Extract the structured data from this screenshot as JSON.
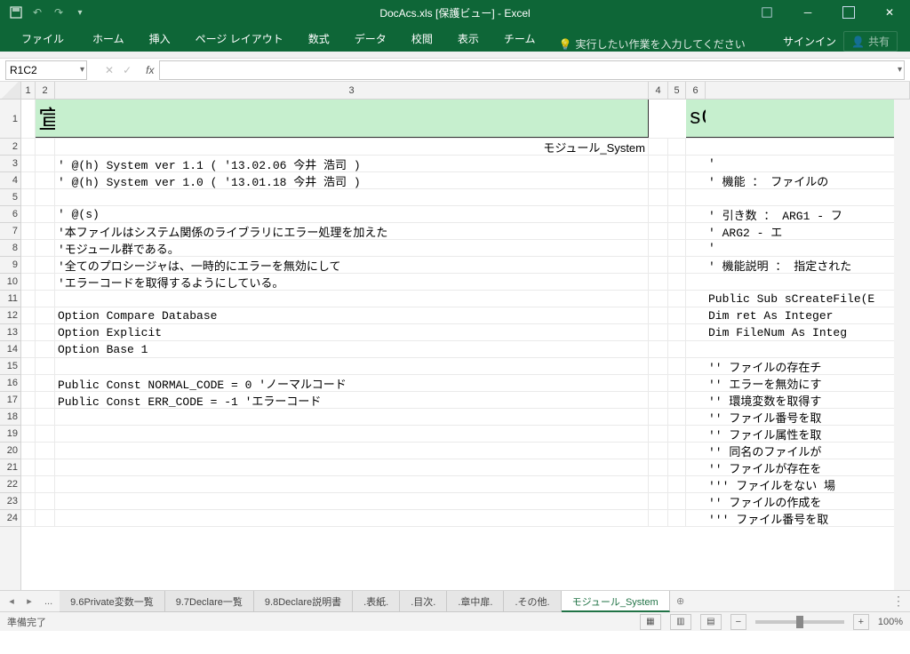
{
  "title_full": "DocAcs.xls  [保護ビュー] - Excel",
  "qat": {
    "undo_arrow": "↶",
    "redo_arrow": "↷"
  },
  "ribbon": {
    "tabs": [
      "ファイル",
      "ホーム",
      "挿入",
      "ページ レイアウト",
      "数式",
      "データ",
      "校閲",
      "表示",
      "チーム"
    ],
    "tellme": "実行したい作業を入力してください",
    "signin": "サインイン",
    "share": "共有"
  },
  "namebox": "R1C2",
  "columns": [
    "1",
    "2",
    "3",
    "4",
    "5",
    "6"
  ],
  "row_labels": [
    "1",
    "2",
    "3",
    "4",
    "5",
    "6",
    "7",
    "8",
    "9",
    "10",
    "11",
    "12",
    "13",
    "14",
    "15",
    "16",
    "17",
    "18",
    "19",
    "20",
    "21",
    "22",
    "23",
    "24"
  ],
  "header_left": "宣言部",
  "header_right": "sCreateFile",
  "module_label": "モジュール_System",
  "left_lines": {
    "r3": "' @(h) System             ver 1.1 ( '13.02.06 今井 浩司 )",
    "r4": "' @(h) System             ver 1.0 ( '13.01.18 今井 浩司 )",
    "r6": "' @(s)",
    "r7": "'本ファイルはシステム関係のライブラリにエラー処理を加えた",
    "r8": "'モジュール群である。",
    "r9": "'全てのプロシージャは、一時的にエラーを無効にして",
    "r10": "'エラーコードを取得するようにしている。",
    "r12": "Option Compare Database",
    "r13": "Option Explicit",
    "r14": "Option Base 1",
    "r16": "Public Const NORMAL_CODE = 0   'ノーマルコード",
    "r17": "Public Const ERR_CODE = -1  'エラーコード"
  },
  "right_lines": {
    "r3": "'",
    "r4": "' 機能     ： ファイルの",
    "r6": "' 引き数   ： ARG1 - フ",
    "r7": "'             ARG2 - エ",
    "r8": "'",
    "r9": "' 機能説明 ： 指定された",
    "r11": "Public Sub sCreateFile(E",
    "r12": "    Dim ret As Integer",
    "r13": "    Dim FileNum As Integ",
    "r15": "    '' ファイルの存在チ",
    "r16": "    '' エラーを無効にす",
    "r17": "    '' 環境変数を取得す",
    "r18": "    '' ファイル番号を取",
    "r19": "    '' ファイル属性を取",
    "r20": "    '' 同名のファイルが",
    "r21": "    '' ファイルが存在を",
    "r22": "    ''' ファイルをない 場",
    "r23": "    '' ファイルの作成を",
    "r24": "    ''' ファイル番号を取"
  },
  "sheet_tabs": [
    "9.6Private変数一覧",
    "9.7Declare一覧",
    "9.8Declare説明書",
    ".表紙.",
    ".目次.",
    ".章中扉.",
    ".その他.",
    "モジュール_System"
  ],
  "active_sheet": 7,
  "status": {
    "ready": "準備完了",
    "zoom": "100%"
  }
}
